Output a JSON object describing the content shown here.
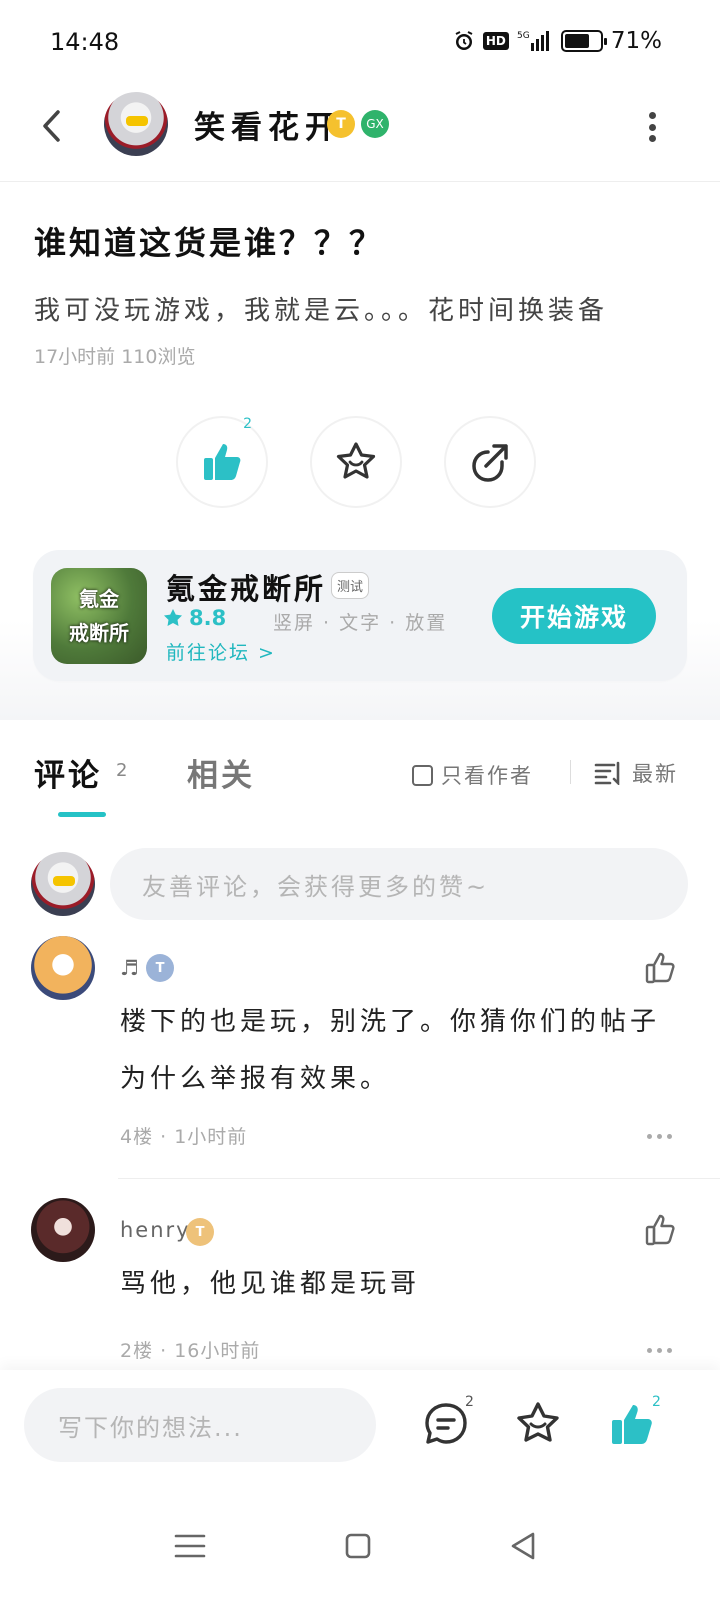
{
  "status_bar": {
    "time": "14:48",
    "hd": "HD",
    "network": "5G",
    "battery": "71%",
    "battery_level": 0.71
  },
  "header": {
    "username": "笑看花开",
    "level_badge": "T",
    "game_badge": "GX"
  },
  "post": {
    "title": "谁知道这货是谁？？？",
    "body": "我可没玩游戏，我就是云。。。花时间换装备",
    "meta": "17小时前 110浏览",
    "like_count": "2"
  },
  "game_card": {
    "icon_text_line1": "氪金",
    "icon_text_line2": "戒断所",
    "name": "氪金戒断所",
    "test_tag": "测试",
    "rating": "8.8",
    "tags": "竖屏 · 文字 · 放置",
    "forum_link": "前往论坛 >",
    "play_button": "开始游戏",
    "accent": "#25c2c6"
  },
  "tabs": {
    "comments_label": "评论",
    "comments_count": "2",
    "related_label": "相关",
    "only_author": "只看作者",
    "sort_label": "最新"
  },
  "composer": {
    "placeholder": "友善评论，会获得更多的赞~"
  },
  "comments": [
    {
      "name": "♬",
      "level": "T",
      "text": "楼下的也是玩，别洗了。你猜你们的帖子为什么举报有效果。",
      "meta": "4楼 · 1小时前"
    },
    {
      "name": "henry",
      "level": "T",
      "text": "骂他，他见谁都是玩哥",
      "meta": "2楼 · 16小时前"
    }
  ],
  "bottom_bar": {
    "placeholder": "写下你的想法...",
    "comment_count": "2",
    "like_count": "2"
  }
}
